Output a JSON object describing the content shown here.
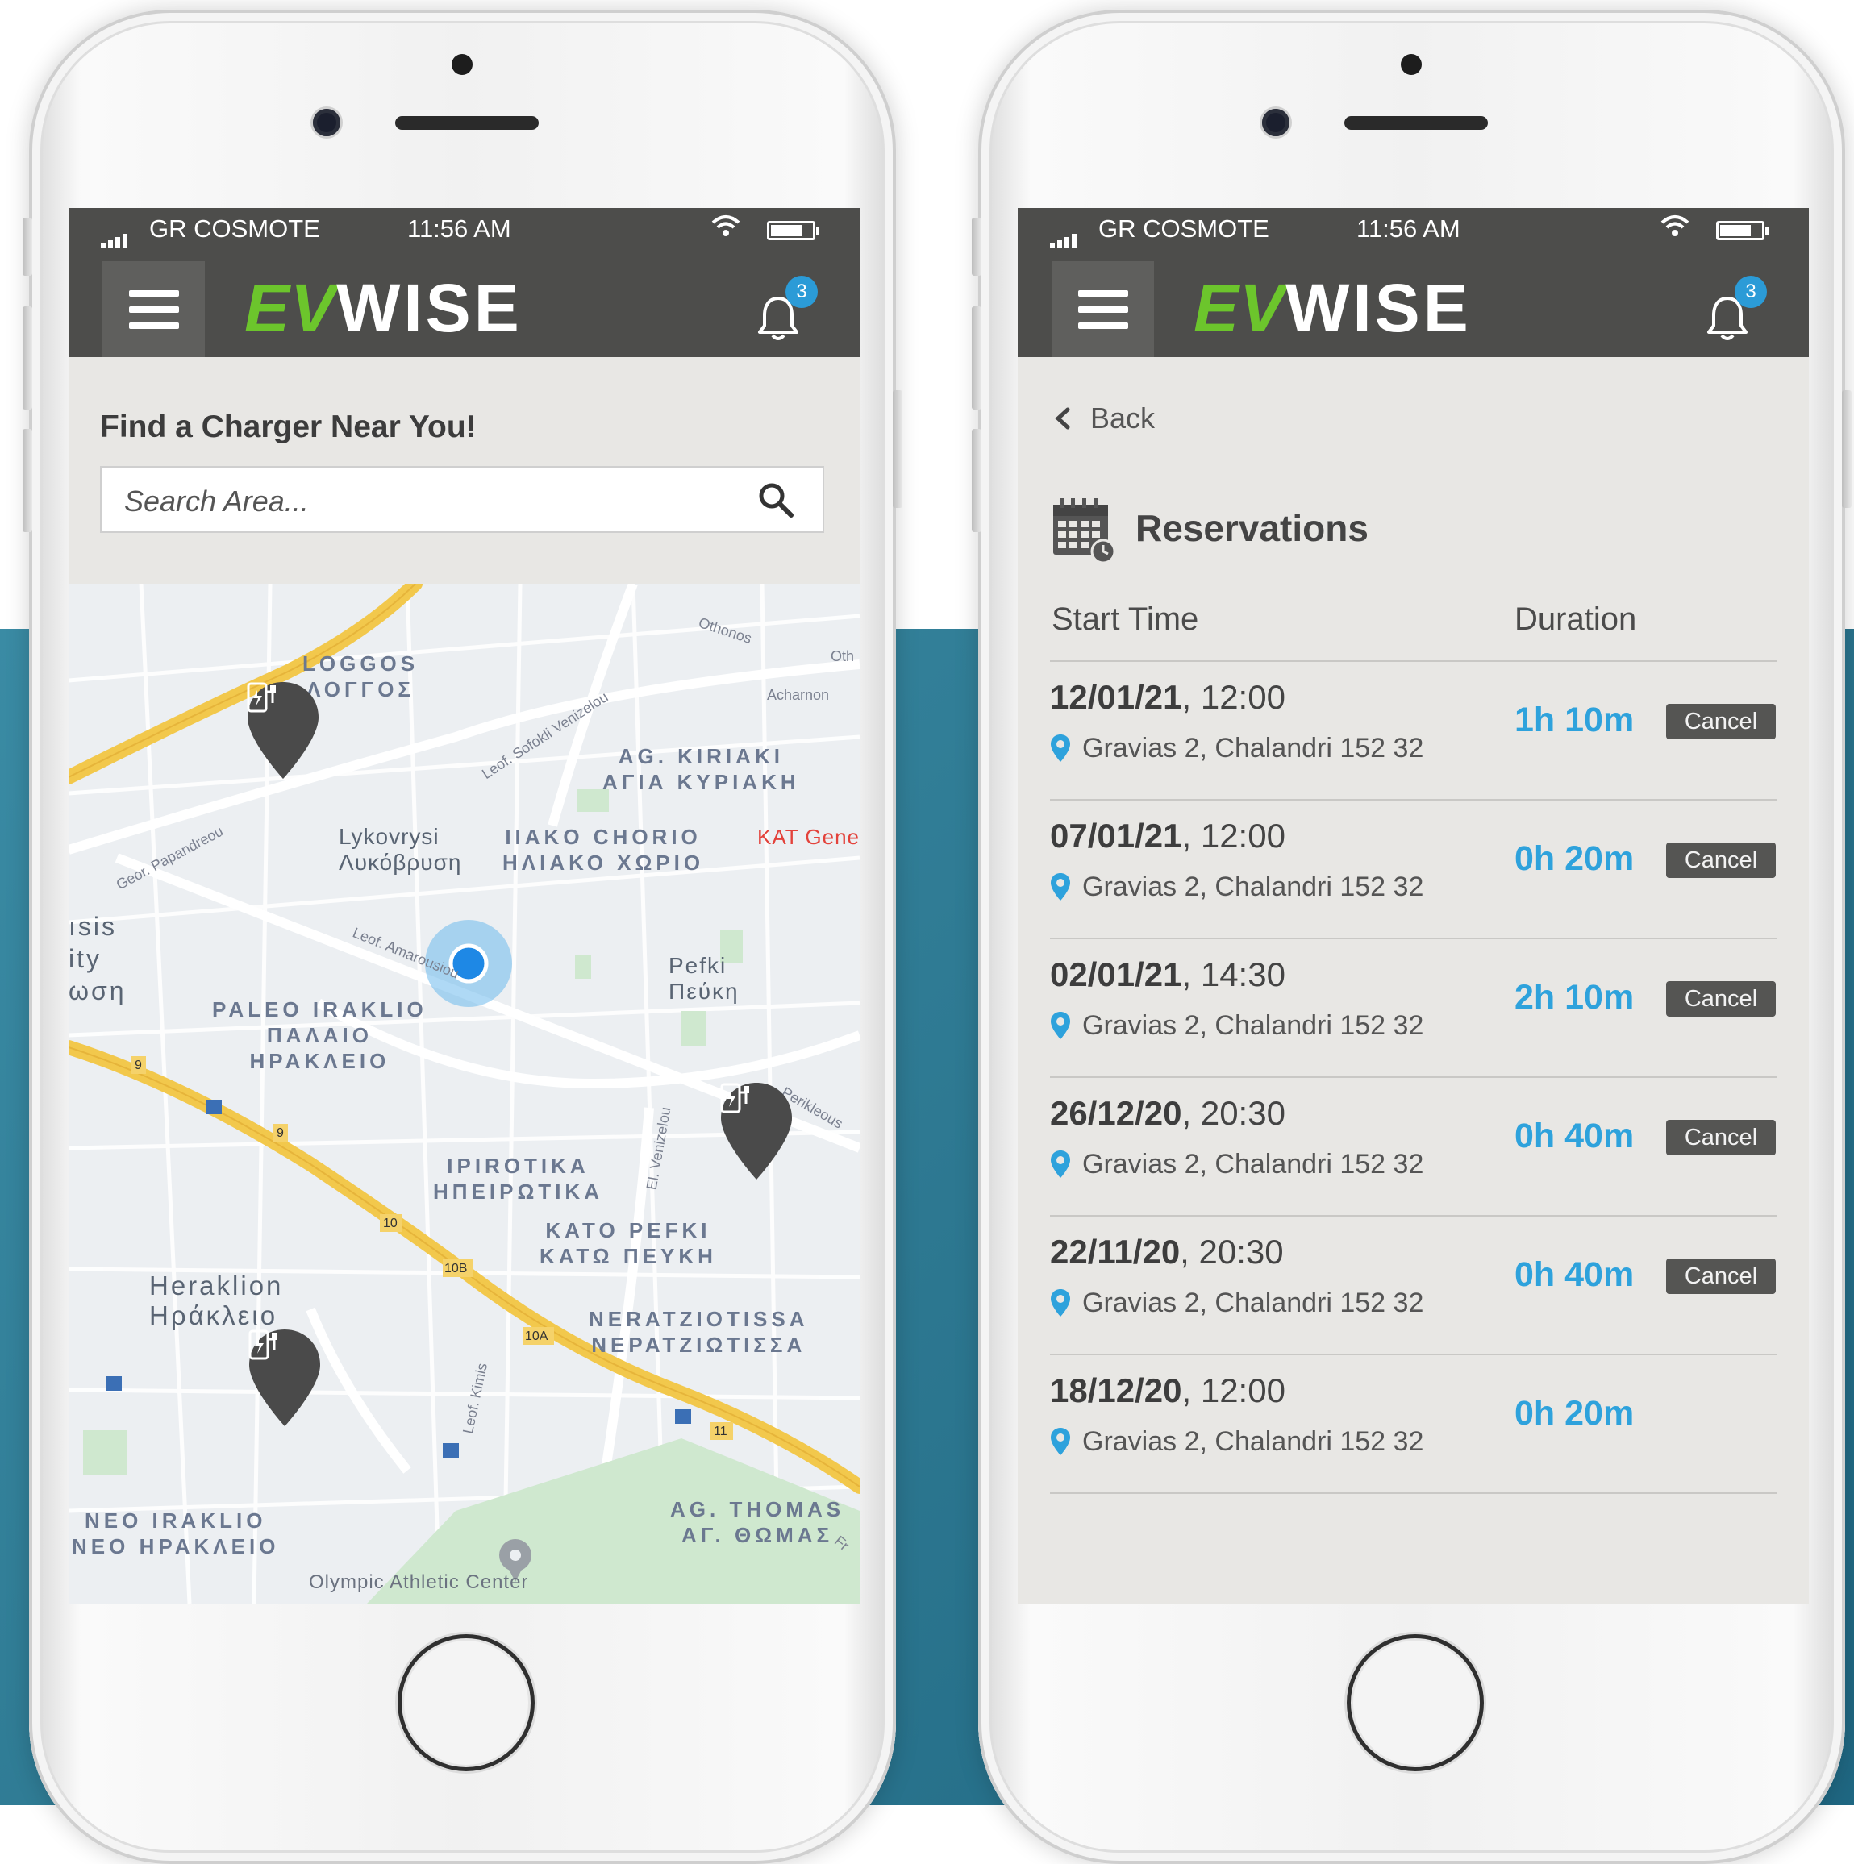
{
  "status_bar": {
    "carrier": "GR COSMOTE",
    "time": "11:56 AM"
  },
  "app": {
    "logo_ev": "EV",
    "logo_wise": "WISE",
    "notification_count": "3",
    "brand_color": "#6cc52c",
    "accent_color": "#2ea2dc"
  },
  "finder": {
    "title": "Find a Charger Near You!",
    "search_placeholder": "Search Area...",
    "map_labels": {
      "loggos": "LOGGOS\nΛΟΓΓΟΣ",
      "ag_kiriaki": "AG. KIRIAKI\nΑΓΙΑ ΚΥΡΙΑΚΗ",
      "lykovrysi": "Lykovrysi\nΛυκόβρυση",
      "iliako": "IIAKO CHORIO\nΗΛΙΑΚΟ ΧΩΡΙΟ",
      "kat": "KAT Gene",
      "asis": "ısis\nity\nωση",
      "pefki": "Pefki\nΠεύκη",
      "paleo": "PALEO IRAKLIO\nΠΑΛΑΙΟ\nΗΡΑΚΛΕΙΟ",
      "ipirotika": "IPIROTIKA\nΗΠΕΙΡΩΤΙΚΑ",
      "kato_pefki": "KATO PEFKI\nΚΑΤΩ ΠΕΥΚΗ",
      "heraklion": "Heraklion\nΗράκλειο",
      "neratziotissa": "NERATZIOTISSA\nΝΕΡΑΤΖΙΩΤΙΣΣΑ",
      "neo_iraklio": "NEO IRAKLIO\nΝΕΟ ΗΡΑΚΛΕΙΟ",
      "ag_thomas": "AG. THOMAS\nΑΓ. ΘΩΜΑΣ",
      "olympic": "Olympic Athletic Center"
    },
    "streets": {
      "othonos": "Othonos",
      "oth": "Oth",
      "acharnon": "Acharnon",
      "venizelou": "Leof. Sofokli Venizelou",
      "papandreou": "Geor. Papandreou",
      "amarousiou": "Leof. Amarousiou",
      "perikleous": "Perikleous",
      "el_venizelou": "El. Venizelou",
      "kimis": "Leof. Kimis",
      "fr": "Fr"
    },
    "road_shields": [
      "9",
      "9",
      "10",
      "10B",
      "10A",
      "11"
    ]
  },
  "reservations": {
    "back_label": "Back",
    "title": "Reservations",
    "columns": {
      "start": "Start Time",
      "duration": "Duration"
    },
    "cancel_label": "Cancel",
    "rows": [
      {
        "date": "12/01/21",
        "time": ", 12:00",
        "address": "Gravias 2, Chalandri 152 32",
        "duration": "1h 10m",
        "cancellable": true
      },
      {
        "date": "07/01/21",
        "time": ", 12:00",
        "address": "Gravias 2, Chalandri 152 32",
        "duration": "0h 20m",
        "cancellable": true
      },
      {
        "date": "02/01/21",
        "time": ", 14:30",
        "address": "Gravias 2, Chalandri 152 32",
        "duration": "2h 10m",
        "cancellable": true
      },
      {
        "date": "26/12/20",
        "time": ", 20:30",
        "address": "Gravias 2, Chalandri 152 32",
        "duration": "0h 40m",
        "cancellable": true
      },
      {
        "date": "22/11/20",
        "time": ", 20:30",
        "address": "Gravias 2, Chalandri 152 32",
        "duration": "0h 40m",
        "cancellable": true
      },
      {
        "date": "18/12/20",
        "time": ", 12:00",
        "address": "Gravias 2, Chalandri 152 32",
        "duration": "0h 20m",
        "cancellable": false
      }
    ]
  }
}
